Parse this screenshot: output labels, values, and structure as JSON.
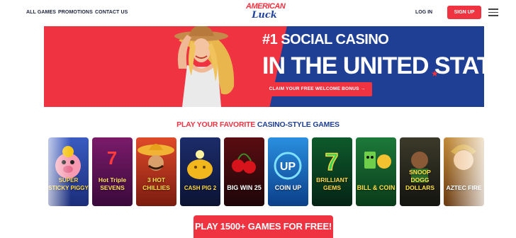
{
  "nav": {
    "all_games": "ALL GAMES",
    "promotions": "PROMOTIONS",
    "contact_us": "CONTACT US",
    "log_in": "LOG IN",
    "sign_up": "SIGN UP"
  },
  "logo": {
    "line1": "AMERICAN",
    "line2": "Luck"
  },
  "hero": {
    "headline_small": "#1 SOCIAL CASINO",
    "headline_large": "IN THE UNITED STATES",
    "cta": "CLAIM YOUR FREE WELCOME BONUS →"
  },
  "games_section": {
    "title_part1": "PLAY YOUR FAVORITE",
    "title_part2": "CASINO-STYLE GAMES",
    "games": [
      {
        "name": "SUPER STICKY PIGGY"
      },
      {
        "name": "Hot Triple SEVENS"
      },
      {
        "name": "3 HOT CHILLIES"
      },
      {
        "name": "CASH PIG 2"
      },
      {
        "name": "BIG WIN 25"
      },
      {
        "name": "COIN UP"
      },
      {
        "name": "BRILLIANT GEMS"
      },
      {
        "name": "BILL & COIN"
      },
      {
        "name": "SNOOP DOGG DOLLARS"
      },
      {
        "name": "AZTEC FIRE"
      }
    ]
  },
  "bottom_cta": "PLAY 1500+ GAMES FOR FREE!",
  "colors": {
    "red": "#ef3341",
    "blue": "#1e3f94",
    "dark": "#1d2340"
  }
}
